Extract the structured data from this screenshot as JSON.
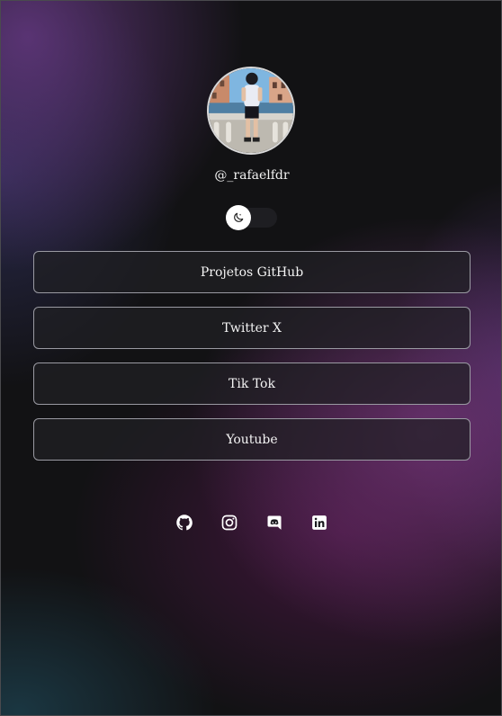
{
  "profile": {
    "username": "@_rafaelfdr",
    "avatar_alt": "profile-photo"
  },
  "theme_toggle": {
    "icon": "moon-icon",
    "state": "off"
  },
  "links": [
    {
      "label": "Projetos GitHub"
    },
    {
      "label": "Twitter X"
    },
    {
      "label": "Tik Tok"
    },
    {
      "label": "Youtube"
    }
  ],
  "socials": [
    {
      "icon": "github-icon"
    },
    {
      "icon": "instagram-icon"
    },
    {
      "icon": "discord-icon"
    },
    {
      "icon": "linkedin-icon"
    }
  ],
  "colors": {
    "background": "#121214",
    "accent_purple": "#6e3c8c",
    "button_border": "#9a9aa2",
    "text": "#ffffff"
  }
}
